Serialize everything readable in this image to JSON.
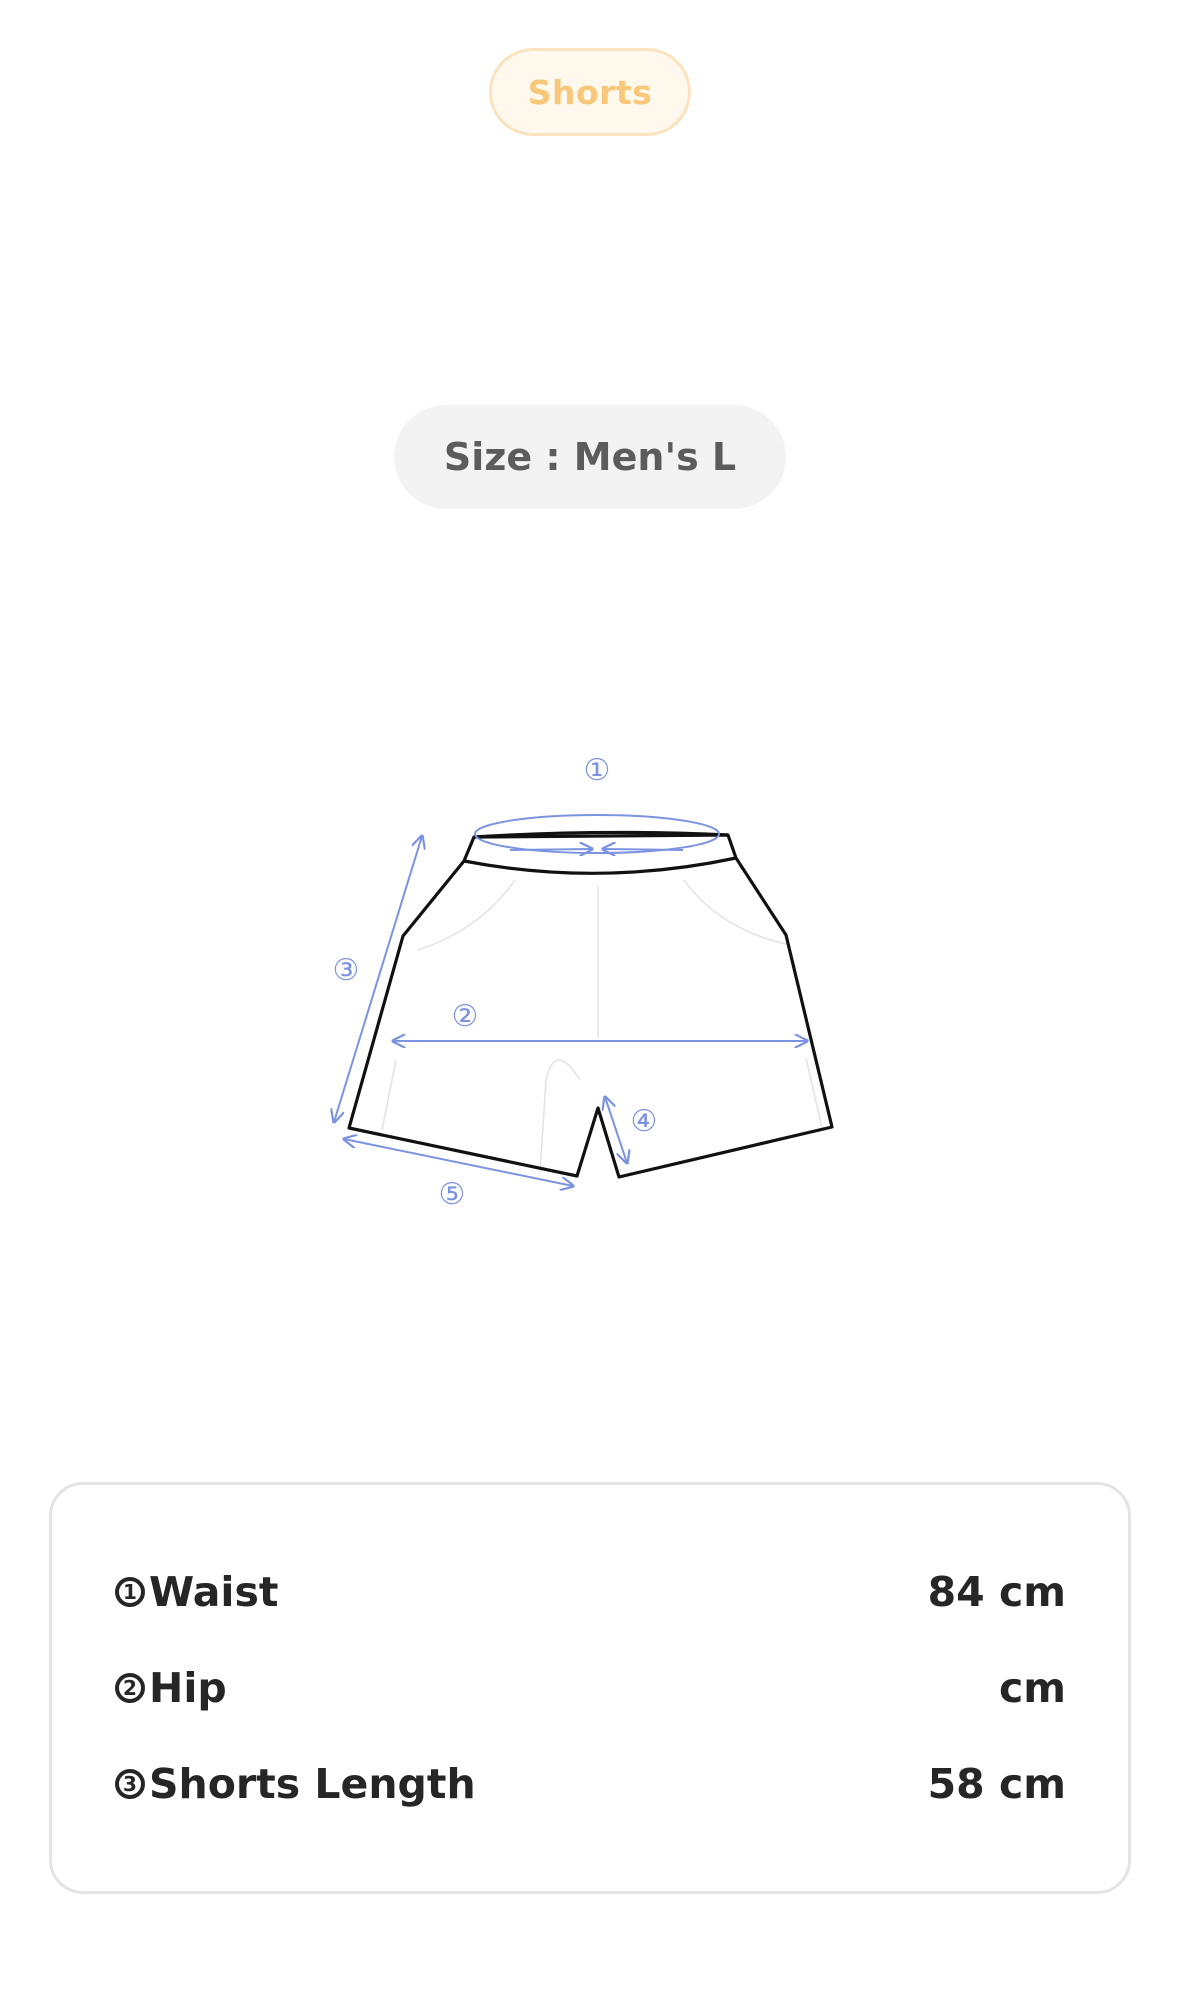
{
  "category": "Shorts",
  "size_label": "Size : Men's L",
  "diagram": {
    "markers": [
      "①",
      "②",
      "③",
      "④",
      "⑤"
    ],
    "outline_color": "#111111",
    "measure_color": "#7b93e0"
  },
  "measurements": [
    {
      "number": "1",
      "label": "Waist",
      "value": "84 cm"
    },
    {
      "number": "2",
      "label": "Hip",
      "value": "cm"
    },
    {
      "number": "3",
      "label": "Shorts Length",
      "value": "58 cm"
    }
  ]
}
